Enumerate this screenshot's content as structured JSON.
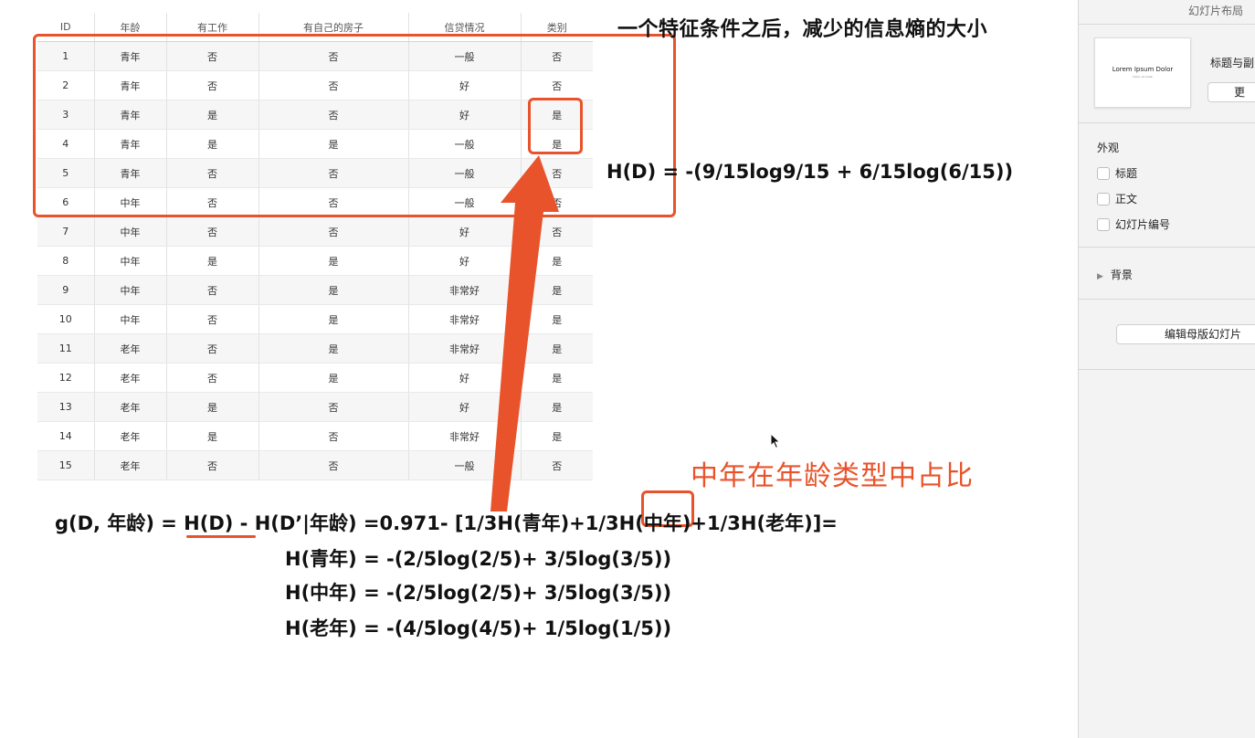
{
  "slide": {
    "table": {
      "headers": [
        "ID",
        "年龄",
        "有工作",
        "有自己的房子",
        "信贷情况",
        "类别"
      ],
      "rows": [
        [
          "1",
          "青年",
          "否",
          "否",
          "一般",
          "否"
        ],
        [
          "2",
          "青年",
          "否",
          "否",
          "好",
          "否"
        ],
        [
          "3",
          "青年",
          "是",
          "否",
          "好",
          "是"
        ],
        [
          "4",
          "青年",
          "是",
          "是",
          "一般",
          "是"
        ],
        [
          "5",
          "青年",
          "否",
          "否",
          "一般",
          "否"
        ],
        [
          "6",
          "中年",
          "否",
          "否",
          "一般",
          "否"
        ],
        [
          "7",
          "中年",
          "否",
          "否",
          "好",
          "否"
        ],
        [
          "8",
          "中年",
          "是",
          "是",
          "好",
          "是"
        ],
        [
          "9",
          "中年",
          "否",
          "是",
          "非常好",
          "是"
        ],
        [
          "10",
          "中年",
          "否",
          "是",
          "非常好",
          "是"
        ],
        [
          "11",
          "老年",
          "否",
          "是",
          "非常好",
          "是"
        ],
        [
          "12",
          "老年",
          "否",
          "是",
          "好",
          "是"
        ],
        [
          "13",
          "老年",
          "是",
          "否",
          "好",
          "是"
        ],
        [
          "14",
          "老年",
          "是",
          "否",
          "非常好",
          "是"
        ],
        [
          "15",
          "老年",
          "否",
          "否",
          "一般",
          "否"
        ]
      ]
    },
    "heading": "一个特征条件之后，减少的信息熵的大小",
    "hd_formula": "H(D) = -(9/15log9/15 + 6/15log(6/15))",
    "annotation": "中年在年龄类型中占比",
    "gain_formula": "g(D, 年龄) = H(D) - H(D’|年龄) =0.971- [1/3H(青年)+1/3H(中年)+1/3H(老年)]=",
    "h_young": "H(青年) = -(2/5log(2/5)+ 3/5log(3/5))",
    "h_middle": "H(中年) = -(2/5log(2/5)+ 3/5log(3/5))",
    "h_old": "H(老年) = -(4/5log(4/5)+ 1/5log(1/5))",
    "accent_color": "#e8532b"
  },
  "side_panel": {
    "title": "幻灯片布局",
    "thumbnail_title": "Lorem Ipsum Dolor",
    "thumbnail_subtitle": "Dolor sit amet",
    "layout_name": "标题与副",
    "change_button": "更",
    "appearance_heading": "外观",
    "checkboxes": [
      "标题",
      "正文",
      "幻灯片编号"
    ],
    "background_label": "背景",
    "edit_master_button": "编辑母版幻灯片"
  }
}
